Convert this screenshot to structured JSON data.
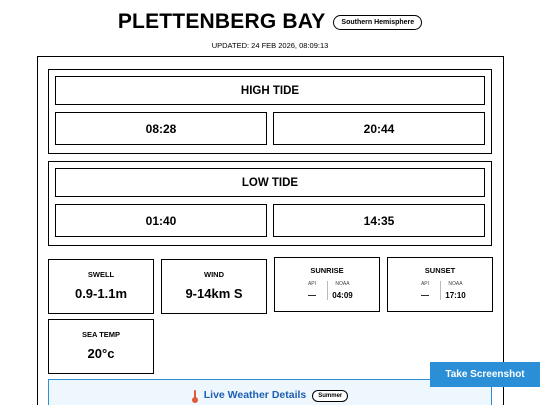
{
  "header": {
    "title": "PLETTENBERG BAY",
    "hemisphere_badge": "Southern Hemisphere",
    "updated": "UPDATED: 24 FEB 2026, 08:09:13"
  },
  "high_tide": {
    "label": "HIGH TIDE",
    "times": [
      "08:28",
      "20:44"
    ]
  },
  "low_tide": {
    "label": "LOW TIDE",
    "times": [
      "01:40",
      "14:35"
    ]
  },
  "conditions": {
    "swell": {
      "label": "SWELL",
      "value": "0.9-1.1m"
    },
    "wind": {
      "label": "WIND",
      "value": "9-14km S"
    },
    "sunrise": {
      "label": "SUNRISE",
      "api_label": "API",
      "noaa_label": "NOAA",
      "api_value": "—",
      "noaa_value": "04:09"
    },
    "sunset": {
      "label": "SUNSET",
      "api_label": "API",
      "noaa_label": "NOAA",
      "api_value": "—",
      "noaa_value": "17:10"
    },
    "sea_temp": {
      "label": "SEA TEMP",
      "value": "20°c"
    }
  },
  "live_weather": {
    "icon": "thermometer-icon",
    "label": "Live Weather Details",
    "season_badge": "Summer"
  },
  "actions": {
    "screenshot_label": "Take Screenshot"
  },
  "colors": {
    "accent": "#2a8fd6",
    "live_text": "#1d5fb0",
    "thermometer": "#e05a3a"
  }
}
